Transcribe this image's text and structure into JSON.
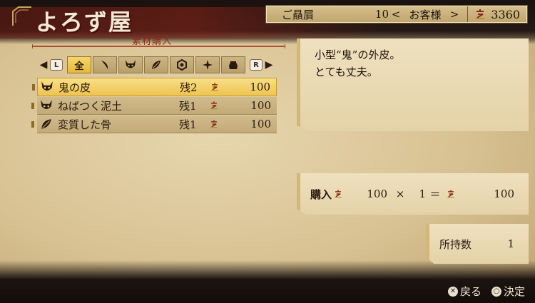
{
  "header": {
    "shop_title": "よろず屋",
    "rank_label": "ご贔屓",
    "rank_value": "10",
    "arrow_left": "<",
    "arrow_right": ">",
    "rank_name": "お客様",
    "money": "3360"
  },
  "section": {
    "title": "素材購入"
  },
  "tabs": {
    "left_arrow": "◀",
    "right_arrow": "▶",
    "left_shoulder": "L",
    "right_shoulder": "R",
    "active_label": "全",
    "icons": [
      "horn-icon",
      "demon-mask-icon",
      "leaf-icon",
      "hexagon-icon",
      "sparkle-icon",
      "pot-icon"
    ]
  },
  "items": [
    {
      "icon": "demon-mask-icon",
      "name": "鬼の皮",
      "stock": "残2",
      "price": "100",
      "selected": true
    },
    {
      "icon": "demon-mask-icon",
      "name": "ねばつく泥土",
      "stock": "残1",
      "price": "100",
      "selected": false
    },
    {
      "icon": "leaf-icon",
      "name": "変質した骨",
      "stock": "残1",
      "price": "100",
      "selected": false
    }
  ],
  "description": {
    "line1": "小型“鬼”の外皮。",
    "line2": "とても丈夫。"
  },
  "purchase": {
    "label": "購入",
    "unit_price": "100",
    "times": "×",
    "quantity": "1",
    "equals": "＝",
    "total": "100"
  },
  "owned": {
    "label": "所持数",
    "value": "1"
  },
  "controls": {
    "back_label": "戻る",
    "confirm_label": "決定"
  },
  "colors": {
    "accent_gold": "#eec452",
    "coin_red": "#8a2a18",
    "ink": "#1a1210"
  }
}
